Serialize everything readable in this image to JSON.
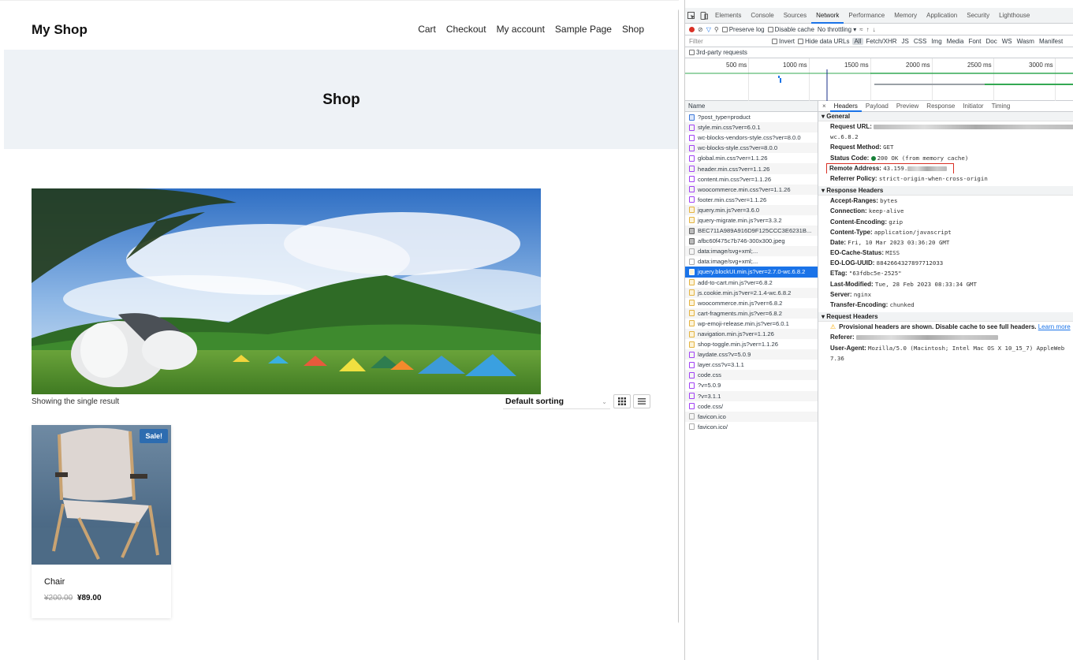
{
  "shop": {
    "site_title": "My Shop",
    "nav": [
      "Cart",
      "Checkout",
      "My account",
      "Sample Page",
      "Shop"
    ],
    "page_title": "Shop",
    "result_count": "Showing the single result",
    "sorting": "Default sorting",
    "product": {
      "badge": "Sale!",
      "name": "Chair",
      "old_price": "¥200.00",
      "new_price": "¥89.00"
    }
  },
  "devtools": {
    "tabs": [
      "Elements",
      "Console",
      "Sources",
      "Network",
      "Performance",
      "Memory",
      "Application",
      "Security",
      "Lighthouse"
    ],
    "active_tab": "Network",
    "toolbar": {
      "preserve_log": "Preserve log",
      "disable_cache": "Disable cache",
      "throttling": "No throttling"
    },
    "filter": {
      "placeholder": "Filter",
      "invert": "Invert",
      "hide_data_urls": "Hide data URLs",
      "types": [
        "All",
        "Fetch/XHR",
        "JS",
        "CSS",
        "Img",
        "Media",
        "Font",
        "Doc",
        "WS",
        "Wasm",
        "Manifest"
      ]
    },
    "third_party": "3rd-party requests",
    "timeline_ticks": [
      "500 ms",
      "1000 ms",
      "1500 ms",
      "2000 ms",
      "2500 ms",
      "3000 ms"
    ],
    "list_header": "Name",
    "requests": [
      {
        "name": "?post_type=product",
        "kind": "doc"
      },
      {
        "name": "style.min.css?ver=6.0.1",
        "kind": "css"
      },
      {
        "name": "wc-blocks-vendors-style.css?ver=8.0.0",
        "kind": "css"
      },
      {
        "name": "wc-blocks-style.css?ver=8.0.0",
        "kind": "css"
      },
      {
        "name": "global.min.css?ver=1.1.26",
        "kind": "css"
      },
      {
        "name": "header.min.css?ver=1.1.26",
        "kind": "css"
      },
      {
        "name": "content.min.css?ver=1.1.26",
        "kind": "css"
      },
      {
        "name": "woocommerce.min.css?ver=1.1.26",
        "kind": "css"
      },
      {
        "name": "footer.min.css?ver=1.1.26",
        "kind": "css"
      },
      {
        "name": "jquery.min.js?ver=3.6.0",
        "kind": "js"
      },
      {
        "name": "jquery-migrate.min.js?ver=3.3.2",
        "kind": "js"
      },
      {
        "name": "BEC711A989A916D9F125CCC3E6231B...",
        "kind": "img"
      },
      {
        "name": "afbc60f475c7b746-300x300.jpeg",
        "kind": "img"
      },
      {
        "name": "data:image/svg+xml;...",
        "kind": "other"
      },
      {
        "name": "data:image/svg+xml;...",
        "kind": "other"
      },
      {
        "name": "jquery.blockUI.min.js?ver=2.7.0-wc.6.8.2",
        "kind": "js",
        "selected": true
      },
      {
        "name": "add-to-cart.min.js?ver=6.8.2",
        "kind": "js"
      },
      {
        "name": "js.cookie.min.js?ver=2.1.4-wc.6.8.2",
        "kind": "js"
      },
      {
        "name": "woocommerce.min.js?ver=6.8.2",
        "kind": "js"
      },
      {
        "name": "cart-fragments.min.js?ver=6.8.2",
        "kind": "js"
      },
      {
        "name": "wp-emoji-release.min.js?ver=6.0.1",
        "kind": "js"
      },
      {
        "name": "navigation.min.js?ver=1.1.26",
        "kind": "js"
      },
      {
        "name": "shop-toggle.min.js?ver=1.1.26",
        "kind": "js"
      },
      {
        "name": "laydate.css?v=5.0.9",
        "kind": "css"
      },
      {
        "name": "layer.css?v=3.1.1",
        "kind": "css"
      },
      {
        "name": "code.css",
        "kind": "css"
      },
      {
        "name": "?v=5.0.9",
        "kind": "css"
      },
      {
        "name": "?v=3.1.1",
        "kind": "css"
      },
      {
        "name": "code.css/",
        "kind": "css"
      },
      {
        "name": "favicon.ico",
        "kind": "other"
      },
      {
        "name": "favicon.ico/",
        "kind": "other"
      }
    ],
    "detail_tabs": [
      "Headers",
      "Payload",
      "Preview",
      "Response",
      "Initiator",
      "Timing"
    ],
    "general": {
      "title": "General",
      "request_url_label": "Request URL:",
      "request_url_tail": "wc.6.8.2",
      "method_label": "Request Method:",
      "method": "GET",
      "status_label": "Status Code:",
      "status": "200 OK (from memory cache)",
      "remote_label": "Remote Address:",
      "remote": "43.159.",
      "referrer_label": "Referrer Policy:",
      "referrer": "strict-origin-when-cross-origin"
    },
    "response_headers": {
      "title": "Response Headers",
      "items": [
        {
          "k": "Accept-Ranges:",
          "v": "bytes"
        },
        {
          "k": "Connection:",
          "v": "keep-alive"
        },
        {
          "k": "Content-Encoding:",
          "v": "gzip"
        },
        {
          "k": "Content-Type:",
          "v": "application/javascript"
        },
        {
          "k": "Date:",
          "v": "Fri, 10 Mar 2023 03:36:20 GMT"
        },
        {
          "k": "EO-Cache-Status:",
          "v": "MISS"
        },
        {
          "k": "EO-LOG-UUID:",
          "v": "8842664327897712033"
        },
        {
          "k": "ETag:",
          "v": "\"63fdbc5e-2525\""
        },
        {
          "k": "Last-Modified:",
          "v": "Tue, 28 Feb 2023 08:33:34 GMT"
        },
        {
          "k": "Server:",
          "v": "nginx"
        },
        {
          "k": "Transfer-Encoding:",
          "v": "chunked"
        }
      ]
    },
    "request_headers": {
      "title": "Request Headers",
      "warning": "Provisional headers are shown. Disable cache to see full headers.",
      "learn_more": "Learn more",
      "referer_label": "Referer:",
      "ua_label": "User-Agent:",
      "ua": "Mozilla/5.0 (Macintosh; Intel Mac OS X 10_15_7) AppleWeb",
      "ua_tail": "7.36"
    }
  }
}
